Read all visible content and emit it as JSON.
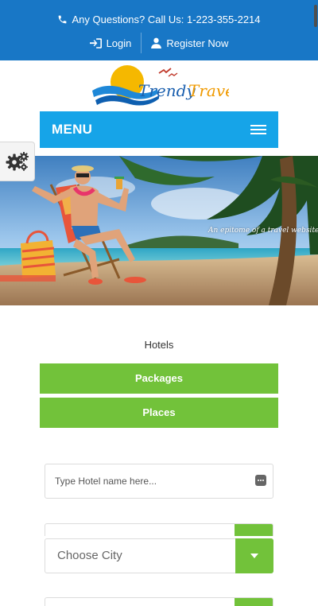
{
  "header": {
    "phone_text": "Any Questions? Call Us: 1-223-355-2214",
    "login_label": "Login",
    "register_label": "Register Now",
    "background_color": "#1877c6"
  },
  "logo": {
    "text": "Trendy Travel"
  },
  "menu": {
    "label": "MENU",
    "background_color": "#16a4e8"
  },
  "hero": {
    "tagline": "An epitome of a travel website"
  },
  "tabs": {
    "hotels_label": "Hotels",
    "packages_label": "Packages",
    "places_label": "Places",
    "accent_color": "#72c23a"
  },
  "search": {
    "hotel_placeholder": "Type Hotel name here...",
    "city_value": "Choose City"
  },
  "icons": [
    "phone-icon",
    "login-icon",
    "user-icon",
    "gears-icon",
    "hamburger-icon",
    "ellipsis-icon",
    "caret-down-icon"
  ]
}
